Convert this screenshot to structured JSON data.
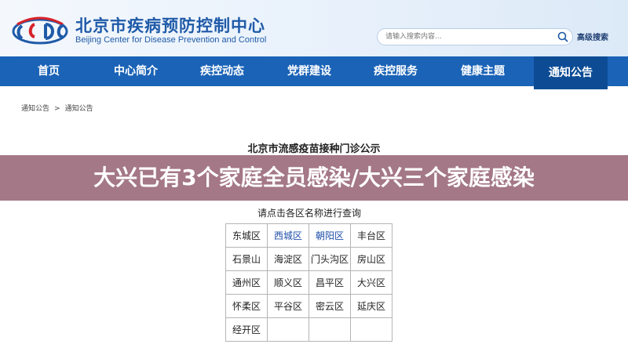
{
  "header": {
    "title": "北京市疾病预防控制中心",
    "subtitle": "Beijing Center for Disease Prevention and Control",
    "search_placeholder": "请输入搜索内容...",
    "advanced_search": "高级搜索"
  },
  "nav": [
    "首页",
    "中心简介",
    "疾控动态",
    "党群建设",
    "疾控服务",
    "健康主题",
    "通知公告"
  ],
  "nav_active": "通知公告",
  "breadcrumb": [
    "通知公告",
    ">",
    "通知公告"
  ],
  "article": {
    "title": "北京市流感疫苗接种门诊公示",
    "instruction": "请点击各区名称进行查询"
  },
  "banner": {
    "text": "大兴已有3个家庭全员感染/大兴三个家庭感染"
  },
  "districts": [
    [
      "东城区",
      "西城区",
      "朝阳区",
      "丰台区"
    ],
    [
      "石景山",
      "海淀区",
      "门头沟区",
      "房山区"
    ],
    [
      "通州区",
      "顺义区",
      "昌平区",
      "大兴区"
    ],
    [
      "怀柔区",
      "平谷区",
      "密云区",
      "延庆区"
    ],
    [
      "经开区",
      "",
      "",
      ""
    ]
  ],
  "colors": {
    "brand": "#1a63b7",
    "nav_active": "#0d4c95",
    "banner": "#a47886",
    "link": "#1f4fa8"
  },
  "icons": {
    "logo": "cdc-logo",
    "search": "search-icon"
  }
}
